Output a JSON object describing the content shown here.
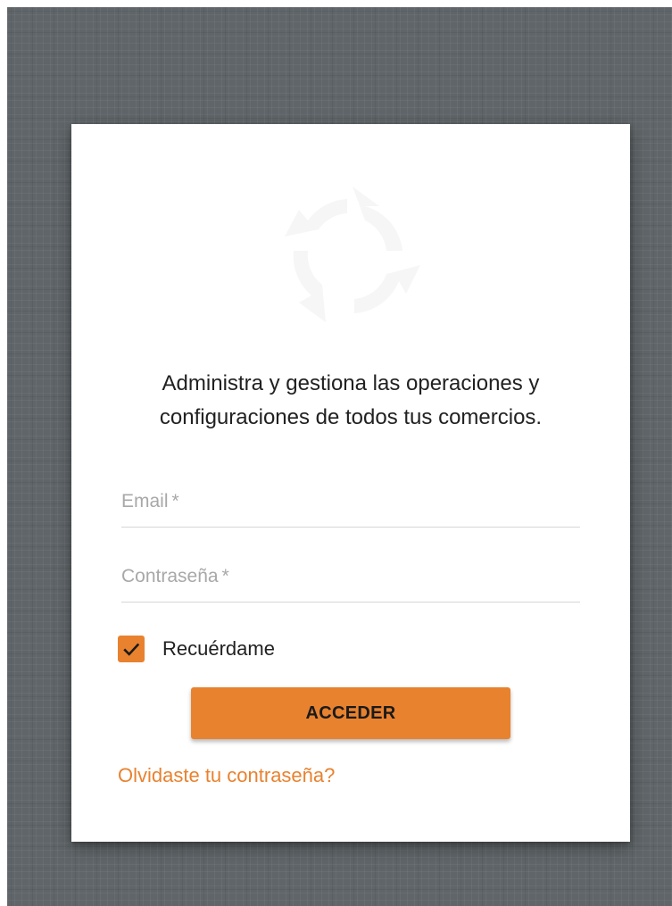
{
  "login": {
    "logo_icon": "circular-arrows-logo",
    "tagline": "Administra y gestiona las operaciones y configuraciones de todos tus comercios.",
    "email": {
      "placeholder": "Email",
      "required_marker": "*",
      "value": ""
    },
    "password": {
      "placeholder": "Contraseña",
      "required_marker": "*",
      "value": ""
    },
    "remember": {
      "label": "Recuérdame",
      "checked": true
    },
    "submit_label": "ACCEDER",
    "forgot_label": "Olvidaste tu contraseña?"
  },
  "colors": {
    "accent": "#e8822f",
    "background": "#5f6568",
    "card": "#ffffff",
    "text": "#212121",
    "placeholder": "#a8a8a8"
  }
}
